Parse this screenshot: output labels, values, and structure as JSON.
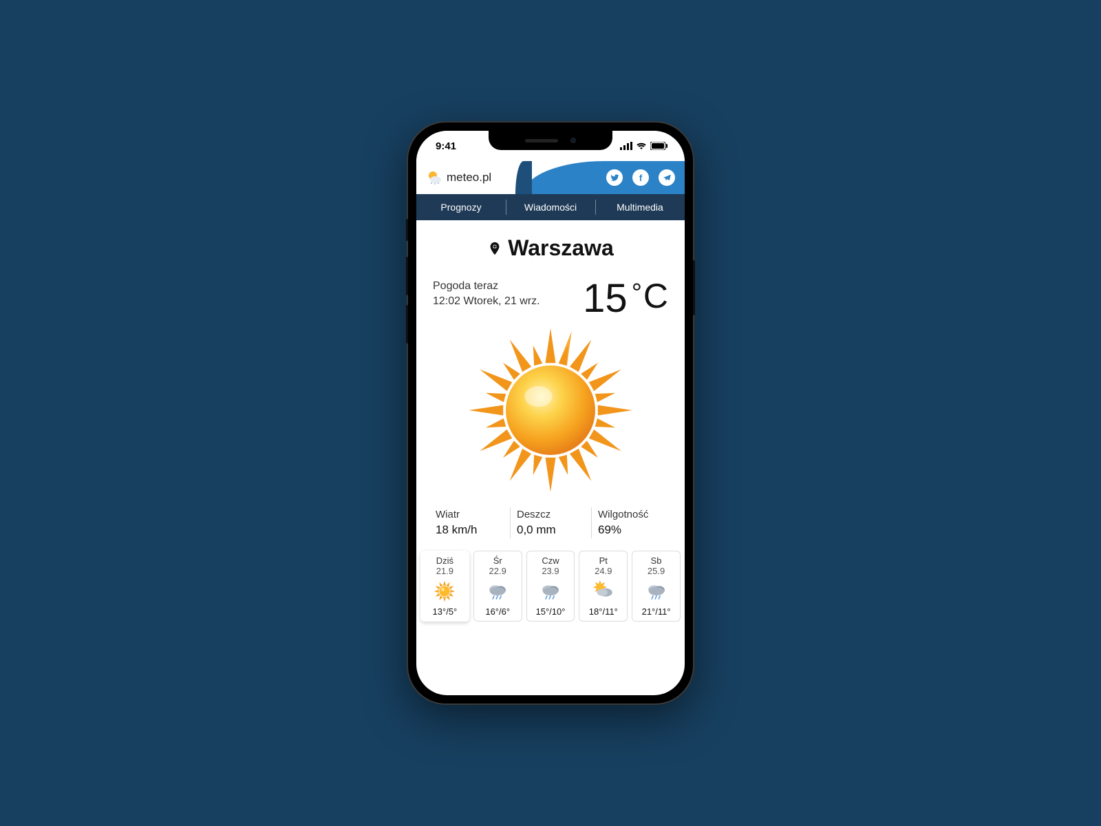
{
  "status_bar": {
    "time": "9:41"
  },
  "header": {
    "brand": "meteo.pl"
  },
  "nav": {
    "items": [
      {
        "label": "Prognozy"
      },
      {
        "label": "Wiadomości"
      },
      {
        "label": "Multimedia"
      }
    ]
  },
  "location": {
    "city": "Warszawa"
  },
  "now": {
    "title": "Pogoda teraz",
    "meta": "12:02 Wtorek, 21 wrz.",
    "temp_value": "15",
    "temp_deg": "°",
    "temp_unit": "C"
  },
  "metrics": {
    "wind": {
      "label": "Wiatr",
      "value": "18 km/h"
    },
    "rain": {
      "label": "Deszcz",
      "value": "0,0 mm"
    },
    "humidity": {
      "label": "Wilgotność",
      "value": "69%"
    }
  },
  "forecast": [
    {
      "day": "Dziś",
      "date": "21.9",
      "icon": "sun",
      "hi_lo": "13°/5°",
      "active": true
    },
    {
      "day": "Śr",
      "date": "22.9",
      "icon": "cloud-rain",
      "hi_lo": "16°/6°",
      "active": false
    },
    {
      "day": "Czw",
      "date": "23.9",
      "icon": "cloud-rain",
      "hi_lo": "15°/10°",
      "active": false
    },
    {
      "day": "Pt",
      "date": "24.9",
      "icon": "sun-cloud",
      "hi_lo": "18°/11°",
      "active": false
    },
    {
      "day": "Sb",
      "date": "25.9",
      "icon": "cloud-rain",
      "hi_lo": "21°/11°",
      "active": false
    }
  ]
}
